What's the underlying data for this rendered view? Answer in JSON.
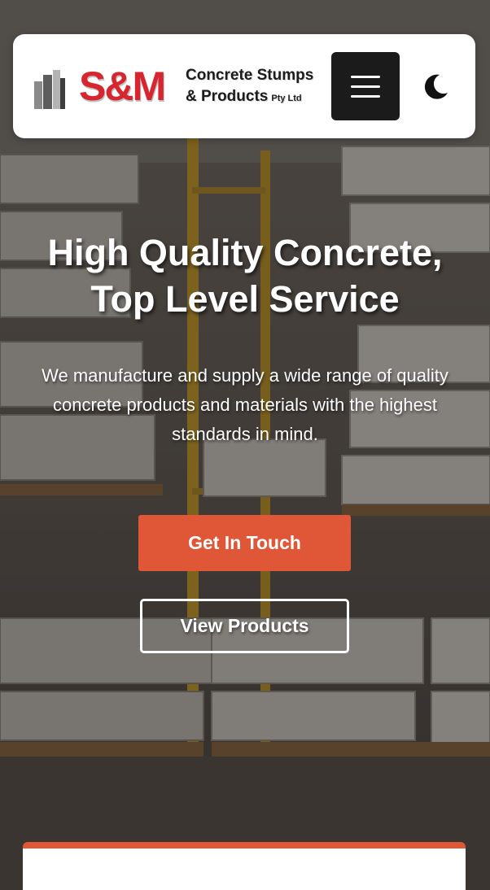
{
  "brand": {
    "mark": "S&M",
    "line1": "Concrete Stumps",
    "line2": "& Products",
    "suffix": "Pty Ltd",
    "colors": {
      "mark": "#d7262f",
      "text": "#1c1c1c"
    }
  },
  "header": {
    "menu_icon": "hamburger-icon",
    "theme_icon": "moon-icon"
  },
  "hero": {
    "title_line1": "High Quality Concrete,",
    "title_line2": "Top Level Service",
    "subtitle": "We manufacture and supply a wide range of quality concrete products and materials with the highest standards in mind.",
    "primary_button": "Get In Touch",
    "secondary_button": "View Products"
  },
  "colors": {
    "accent": "#e05737",
    "header_bg": "#ffffff",
    "menu_button_bg": "#1b1b1b"
  }
}
